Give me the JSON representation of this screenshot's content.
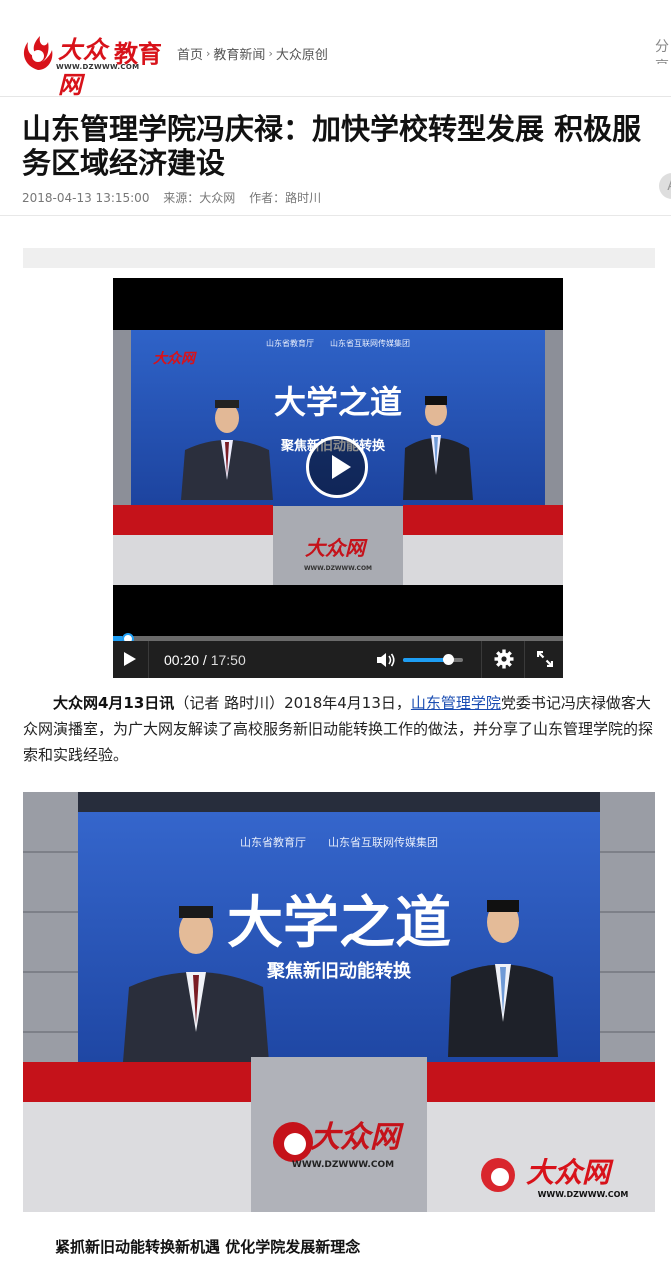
{
  "header": {
    "logo_text": "大众网",
    "logo_url": "WWW.DZWWW.COM",
    "section": "教育",
    "breadcrumb": [
      "首页",
      "教育新闻",
      "大众原创"
    ],
    "share_edge": "分享"
  },
  "article": {
    "title": "山东管理学院冯庆禄：加快学校转型发展 积极服务区域经济建设",
    "date": "2018-04-13 13:15:00",
    "source_label": "来源：",
    "source": "大众网",
    "author_label": "作者：",
    "author": "路时川",
    "font_button": "A",
    "para_lead": "大众网4月13日讯",
    "para_part1": "（记者 路时川）2018年4月13日，",
    "para_link": "山东管理学院",
    "para_part2": "党委书记冯庆禄做客大众网演播室，为广大网友解读了高校服务新旧动能转换工作的做法，并分享了山东管理学院的探索和实践经验。",
    "subhead": "紧抓新旧动能转换新机遇 优化学院发展新理念"
  },
  "video": {
    "current_time": "00:20",
    "separator": " / ",
    "duration": "17:50",
    "progress": 0.019,
    "volume": 0.72
  },
  "studio": {
    "banner": "山东省教育厅　　山东省互联网传媒集团",
    "show_title": "大学之道",
    "show_subtitle": "聚焦新旧动能转换",
    "desk_logo": "大众网",
    "desk_url": "WWW.DZWWW.COM",
    "watermark_logo": "大众网",
    "watermark_url": "WWW.DZWWW.COM"
  },
  "colors": {
    "brand_red": "#d8121a",
    "progress_blue": "#1e9ef4",
    "link_blue": "#1a4db2"
  }
}
